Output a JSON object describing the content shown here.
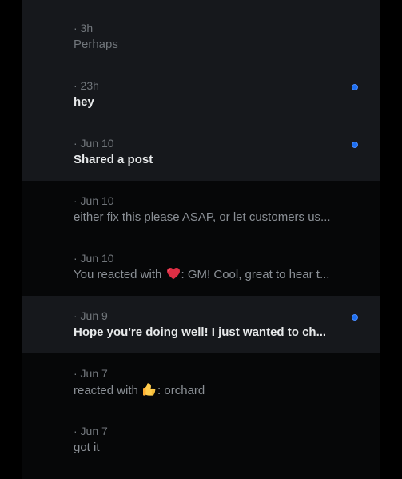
{
  "colors": {
    "page_background": "#000000",
    "unread_row": "#16181c",
    "read_row": "#060708",
    "unread_dot": "#1d6ff2",
    "meta_text": "#71767b",
    "bold_text": "#e7e9ea"
  },
  "conversations": [
    {
      "time": "· 3h",
      "preview": "Perhaps",
      "unread": false
    },
    {
      "time": "· 23h",
      "preview": "hey",
      "unread": true
    },
    {
      "time": "· Jun 10",
      "preview": "Shared a post",
      "unread": true
    },
    {
      "time": "· Jun 10",
      "preview": "either fix this please ASAP, or let customers us...",
      "unread": false
    },
    {
      "time": "· Jun 10",
      "preview_prefix": "You reacted with ",
      "reaction_icon": "red-heart-icon",
      "preview_suffix": ": GM! Cool, great to hear t...",
      "unread": false
    },
    {
      "time": "· Jun 9",
      "preview": "Hope you're doing well! I just wanted to ch...",
      "unread": true
    },
    {
      "time": "· Jun 7",
      "preview_prefix": "reacted with ",
      "reaction_icon": "thumbs-up-icon",
      "preview_suffix": ": orchard",
      "unread": false
    },
    {
      "time": "· Jun 7",
      "preview": "got it",
      "unread": false
    }
  ]
}
